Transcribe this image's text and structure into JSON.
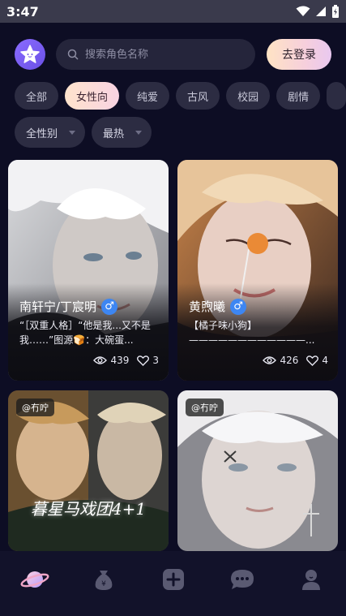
{
  "status_bar": {
    "time": "3:47"
  },
  "header": {
    "search_placeholder": "搜索角色名称",
    "login_label": "去登录"
  },
  "tabs": [
    {
      "label": "全部"
    },
    {
      "label": "女性向"
    },
    {
      "label": "纯爱"
    },
    {
      "label": "古风"
    },
    {
      "label": "校园"
    },
    {
      "label": "剧情"
    }
  ],
  "filters": [
    {
      "label": "全性别"
    },
    {
      "label": "最热"
    }
  ],
  "cards": [
    {
      "name": "南轩宁/丁宸明",
      "gender_symbol": "♂",
      "description": "“［双重人格］“他是我...又不是我……”图源🍞：大碗蛋...",
      "views": "439",
      "likes": "3"
    },
    {
      "name": "黄煦曦",
      "gender_symbol": "♂",
      "description": "【橘子味小狗】\n————————————...",
      "views": "426",
      "likes": "4"
    },
    {
      "author": "@冇咛",
      "title_art": "暮星马戏团4+1"
    },
    {
      "author": "@冇咛"
    }
  ],
  "bottom_nav": [
    {
      "icon": "planet-icon",
      "active": true
    },
    {
      "icon": "money-bag-icon",
      "active": false
    },
    {
      "icon": "plus-square-icon",
      "active": false
    },
    {
      "icon": "chat-bubble-icon",
      "active": false
    },
    {
      "icon": "profile-icon",
      "active": false
    }
  ],
  "colors": {
    "background": "#0d0d24",
    "accent": "#8a6cff",
    "chip": "#2c2c42",
    "gender_male": "#3d86f2"
  }
}
